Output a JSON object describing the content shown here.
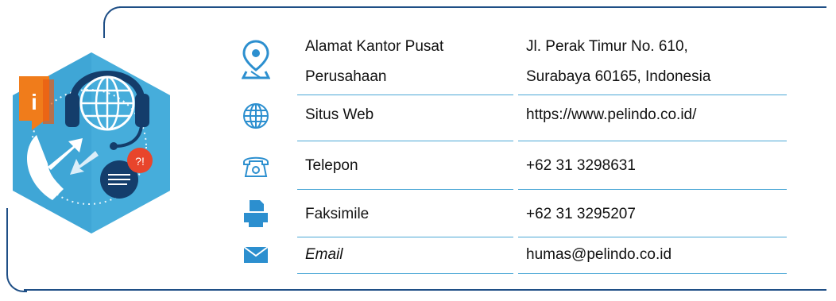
{
  "contacts": [
    {
      "icon": "location-pin-icon",
      "label_lines": [
        "Alamat Kantor Pusat",
        "Perusahaan"
      ],
      "value_lines": [
        "Jl. Perak Timur No. 610,",
        "Surabaya 60165, Indonesia"
      ]
    },
    {
      "icon": "globe-icon",
      "label": "Situs Web",
      "value": "https://www.pelindo.co.id/"
    },
    {
      "icon": "telephone-icon",
      "label": "Telepon",
      "value": "+62 31 3298631"
    },
    {
      "icon": "fax-icon",
      "label": "Faksimile",
      "value": "+62 31 3295207"
    },
    {
      "icon": "email-icon",
      "label": "Email",
      "value": "humas@pelindo.co.id"
    }
  ],
  "illustration": {
    "info_badge": "i",
    "question_bubble": "?!"
  },
  "colors": {
    "frame": "#1f4f86",
    "accent_light": "#4aa7d6",
    "hexagon": "#3fa6d6",
    "info_orange": "#f07c1b",
    "bubble_red": "#e8452c"
  }
}
